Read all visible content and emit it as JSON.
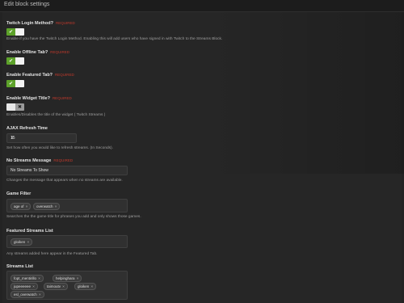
{
  "dialog": {
    "title": "Edit block settings"
  },
  "required_text": "REQUIRED",
  "settings": {
    "twitch_login": {
      "label": "Twitch Login Method?",
      "desc": "Enable if you have the Twitch Login Method. Enabling this will add users who have signed in with Twitch to the Streams Block.",
      "on": true
    },
    "offline_tab": {
      "label": "Enable Offline Tab?",
      "on": true
    },
    "featured_tab": {
      "label": "Enable Featured Tab?",
      "on": true
    },
    "widget_title": {
      "label": "Enable Widget Title?",
      "desc": "Enables/Disables the title of the widget ( Twitch Streams )",
      "on": false
    },
    "ajax_refresh": {
      "label": "AJAX Refresh Time",
      "value": "15",
      "desc": "Set how often you would like to refresh streams. (In Seconds)."
    },
    "no_streams": {
      "label": "No Streams Message",
      "value": "No Streams To Show",
      "desc": "Changes the message that appears when no streams are available."
    },
    "game_filter": {
      "label": "Game Filter",
      "tags": [
        "age of",
        "overwatch"
      ],
      "desc": "Searches the the game title for phrases you add and only shows those games."
    },
    "featured_list": {
      "label": "Featured Streams List",
      "tags": [
        "gloiken"
      ],
      "desc": "Any streams added here appear in the Featured Tab."
    },
    "streams_list": {
      "label": "Streams List",
      "tags": [
        "fopt_mentirillo",
        "helpinghara",
        "jupeeeeee",
        "taimoutv",
        "gloiken",
        "esl_overwatch"
      ]
    }
  },
  "icons": {
    "check": "check-icon",
    "cross": "cross-icon"
  },
  "colors": {
    "toggle_on": "#5da22a",
    "required": "#c0392b"
  }
}
